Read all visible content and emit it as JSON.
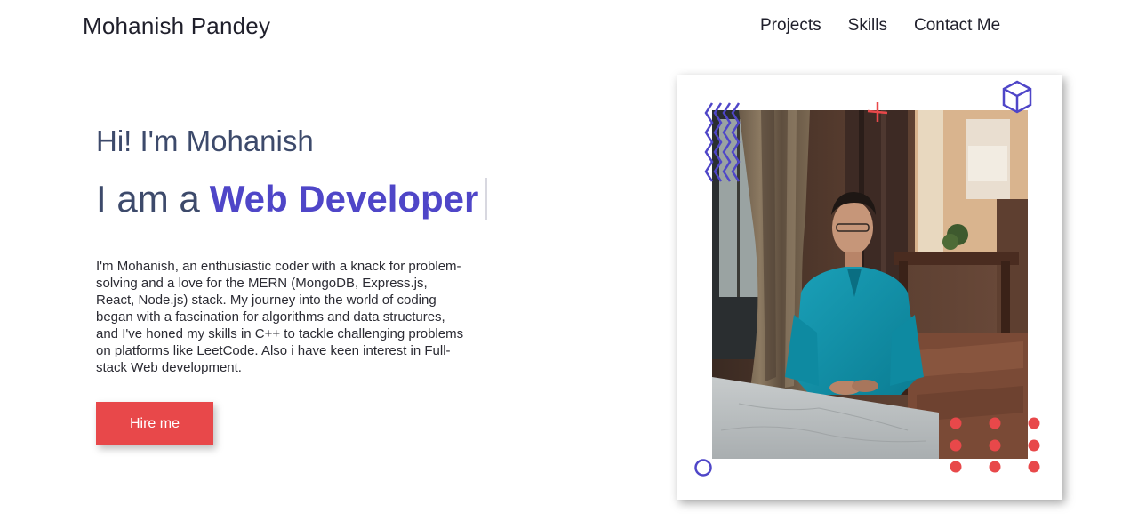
{
  "nav": {
    "brand": "Mohanish Pandey",
    "links": [
      "Projects",
      "Skills",
      "Contact Me"
    ]
  },
  "hero": {
    "greeting": "Hi! I'm Mohanish",
    "role_prefix": "I am a",
    "role_highlight": "Web Developer",
    "bio": "I'm Mohanish, an enthusiastic coder with a knack for problem-solving and a love for the MERN (MongoDB, Express.js, React, Node.js) stack. My journey into the world of coding began with a fascination for algorithms and data structures, and I've honed my skills in C++ to tackle challenging problems on platforms like LeetCode. Also i have keen interest in Full-stack Web development.",
    "cta_label": "Hire me"
  },
  "photo": {
    "subject": "profile-photo"
  },
  "colors": {
    "accent": "#4f46c8",
    "cta": "#e8484a",
    "heading": "#3d4a6b"
  }
}
